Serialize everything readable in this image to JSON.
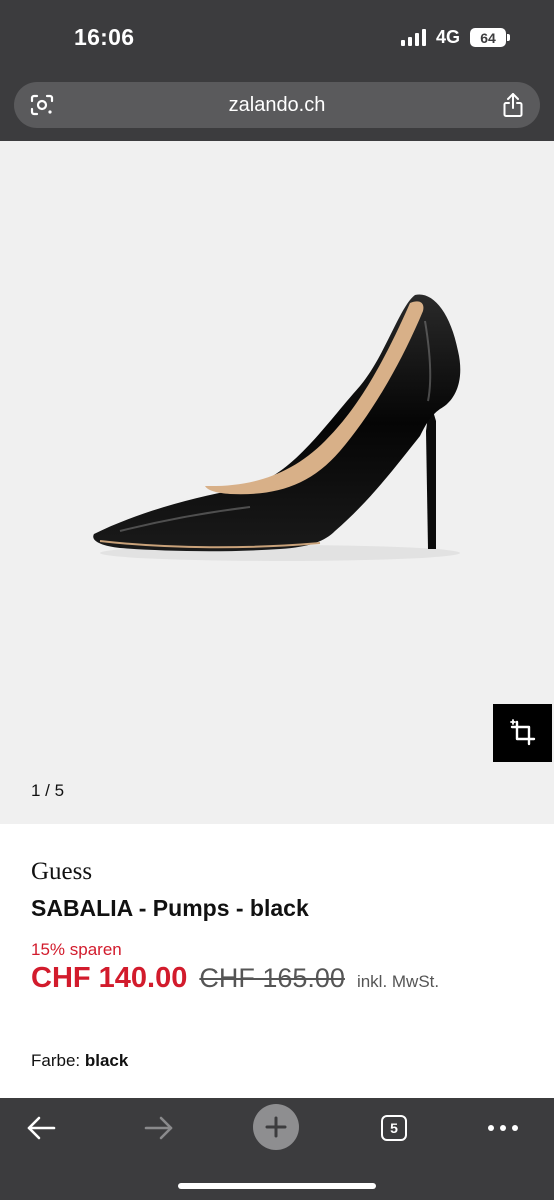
{
  "status": {
    "time": "16:06",
    "network": "4G",
    "battery": "64"
  },
  "browser": {
    "url": "zalando.ch",
    "tab_count": "5"
  },
  "gallery": {
    "counter": "1 / 5"
  },
  "product": {
    "brand": "Guess",
    "title": "SABALIA - Pumps - black",
    "discount": "15% sparen",
    "price": "CHF 140.00",
    "old_price": "CHF 165.00",
    "vat_note": "inkl. MwSt.",
    "color_label": "Farbe:",
    "color_value": "black"
  },
  "icons": [
    "lens-icon",
    "share-icon",
    "crop-icon",
    "back-arrow-icon",
    "forward-arrow-icon",
    "new-tab-plus-icon",
    "tabs-icon",
    "more-icon"
  ],
  "colors": {
    "bar": "#3c3c3e",
    "sale_red": "#d21b2c",
    "gallery_bg": "#f0f0f0"
  }
}
